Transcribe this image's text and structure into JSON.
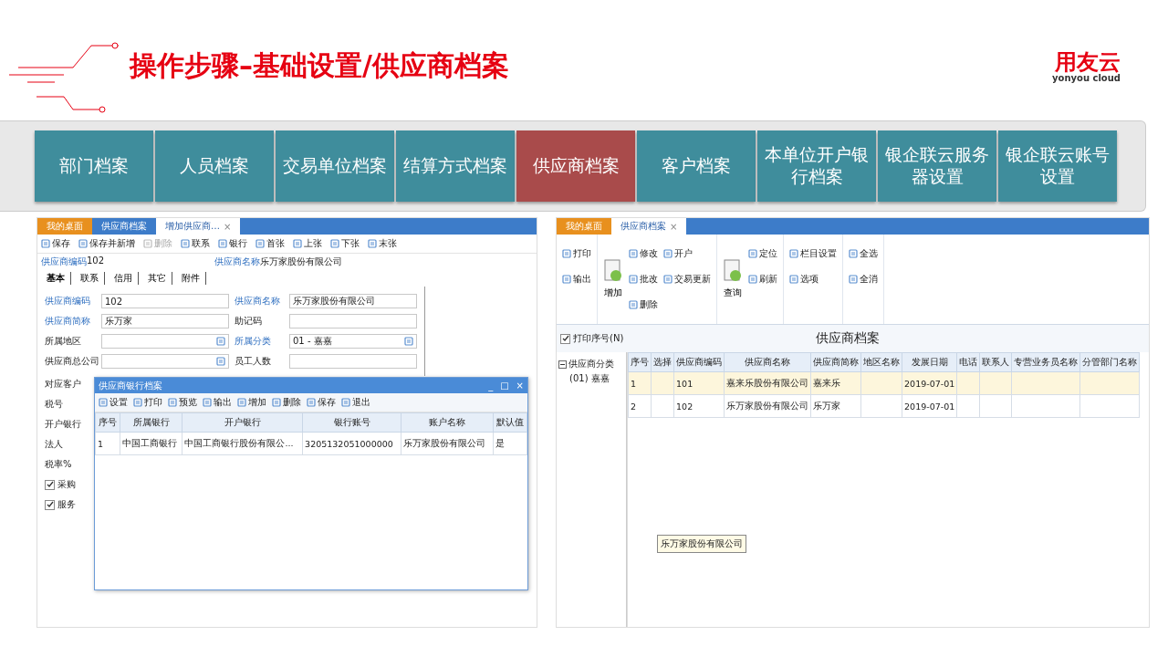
{
  "slide": {
    "title": "操作步骤–基础设置/供应商档案",
    "logo": {
      "mark": "用友云",
      "caption": "yonyou cloud"
    }
  },
  "nav_tabs": [
    {
      "label": "部门档案",
      "selected": false
    },
    {
      "label": "人员档案",
      "selected": false
    },
    {
      "label": "交易单位档案",
      "selected": false
    },
    {
      "label": "结算方式档案",
      "selected": false
    },
    {
      "label": "供应商档案",
      "selected": true
    },
    {
      "label": "客户档案",
      "selected": false
    },
    {
      "label": "本单位开户银行档案",
      "selected": false
    },
    {
      "label": "银企联云服务器设置",
      "selected": false
    },
    {
      "label": "银企联云账号设置",
      "selected": false
    }
  ],
  "left_screen": {
    "tabs": [
      {
        "label": "我的桌面",
        "kind": "home",
        "selected": false
      },
      {
        "label": "供应商档案",
        "kind": "page",
        "selected": false
      },
      {
        "label": "增加供应商…",
        "kind": "page",
        "selected": true,
        "close": "×"
      }
    ],
    "toolbar": [
      {
        "label": "保存",
        "disabled": false
      },
      {
        "label": "保存并新增",
        "disabled": false
      },
      {
        "label": "删除",
        "disabled": true
      },
      {
        "label": "联系",
        "disabled": false
      },
      {
        "label": "银行",
        "disabled": false
      },
      {
        "label": "首张",
        "disabled": false
      },
      {
        "label": "上张",
        "disabled": false
      },
      {
        "label": "下张",
        "disabled": false
      },
      {
        "label": "末张",
        "disabled": false
      }
    ],
    "header": [
      {
        "label": "供应商编码",
        "value": "102"
      },
      {
        "label": "供应商名称",
        "value": "乐万家股份有限公司"
      }
    ],
    "sub_tabs": [
      {
        "label": "基本",
        "selected": true
      },
      {
        "label": "联系",
        "selected": false
      },
      {
        "label": "信用",
        "selected": false
      },
      {
        "label": "其它",
        "selected": false
      },
      {
        "label": "附件",
        "selected": false
      }
    ],
    "fields": [
      {
        "label": "供应商编码",
        "required": true,
        "value": "102"
      },
      {
        "label": "供应商名称",
        "required": true,
        "value": "乐万家股份有限公司"
      },
      {
        "label": "供应商简称",
        "required": true,
        "value": "乐万家"
      },
      {
        "label": "助记码",
        "required": false
      },
      {
        "label": "所属地区",
        "required": false,
        "lookup": true
      },
      {
        "label": "所属分类",
        "required": true,
        "value": "01 - 嘉嘉",
        "lookup": true
      },
      {
        "label": "供应商总公司",
        "required": false,
        "lookup": true
      },
      {
        "label": "员工人数",
        "required": false
      }
    ],
    "side_labels": [
      "对应客户",
      "税号",
      "开户银行",
      "法人",
      "税率%"
    ],
    "checkboxes": [
      {
        "label": "采购",
        "checked": true
      },
      {
        "label": "服务",
        "checked": true
      }
    ],
    "dialog": {
      "title": "供应商银行档案",
      "controls": [
        "_",
        "□",
        "×"
      ],
      "toolbar": [
        "设置",
        "打印",
        "预览",
        "输出",
        "增加",
        "删除",
        "保存",
        "退出"
      ],
      "columns": [
        "序号",
        "所属银行",
        "开户银行",
        "银行账号",
        "账户名称",
        "默认值"
      ],
      "rows": [
        [
          "1",
          "中国工商银行",
          "中国工商银行股份有限公...",
          "3205132051000000",
          "乐万家股份有限公司",
          "是"
        ]
      ]
    }
  },
  "right_screen": {
    "tabs": [
      {
        "label": "我的桌面",
        "kind": "home",
        "selected": false
      },
      {
        "label": "供应商档案",
        "kind": "page",
        "selected": true,
        "close": "×"
      }
    ],
    "ribbon": [
      [
        {
          "label": "打印",
          "kind": "small"
        },
        {
          "label": "输出",
          "kind": "small"
        }
      ],
      [
        {
          "label": "增加",
          "kind": "large"
        },
        {
          "label": "修改",
          "kind": "small"
        },
        {
          "label": "批改",
          "kind": "small"
        },
        {
          "label": "删除",
          "kind": "small"
        },
        {
          "label": "开户",
          "kind": "small"
        },
        {
          "label": "交易更新",
          "kind": "small"
        }
      ],
      [
        {
          "label": "查询",
          "kind": "large"
        },
        {
          "label": "定位",
          "kind": "small"
        },
        {
          "label": "刷新",
          "kind": "small"
        }
      ],
      [
        {
          "label": "栏目设置",
          "kind": "small"
        },
        {
          "label": "选项",
          "kind": "small"
        }
      ],
      [
        {
          "label": "全选",
          "kind": "small"
        },
        {
          "label": "全消",
          "kind": "small"
        }
      ]
    ],
    "print_index": {
      "label": "打印序号(N)",
      "checked": true
    },
    "title": "供应商档案",
    "tree": [
      {
        "label": "供应商分类",
        "expanded": true,
        "children": [
          {
            "label": "(01) 嘉嘉"
          }
        ]
      }
    ],
    "columns": [
      "序号",
      "选择",
      "供应商编码",
      "供应商名称",
      "供应商简称",
      "地区名称",
      "发展日期",
      "电话",
      "联系人",
      "专营业务员名称",
      "分管部门名称"
    ],
    "rows": [
      {
        "selected": true,
        "cells": [
          "1",
          null,
          "101",
          "嘉来乐股份有限公司",
          "嘉来乐",
          null,
          "2019-07-01",
          null,
          null,
          null,
          null
        ]
      },
      {
        "selected": false,
        "cells": [
          "2",
          null,
          "102",
          "乐万家股份有限公司",
          "乐万家",
          null,
          "2019-07-01",
          null,
          null,
          null,
          null
        ]
      }
    ],
    "tooltip": "乐万家股份有限公司"
  }
}
